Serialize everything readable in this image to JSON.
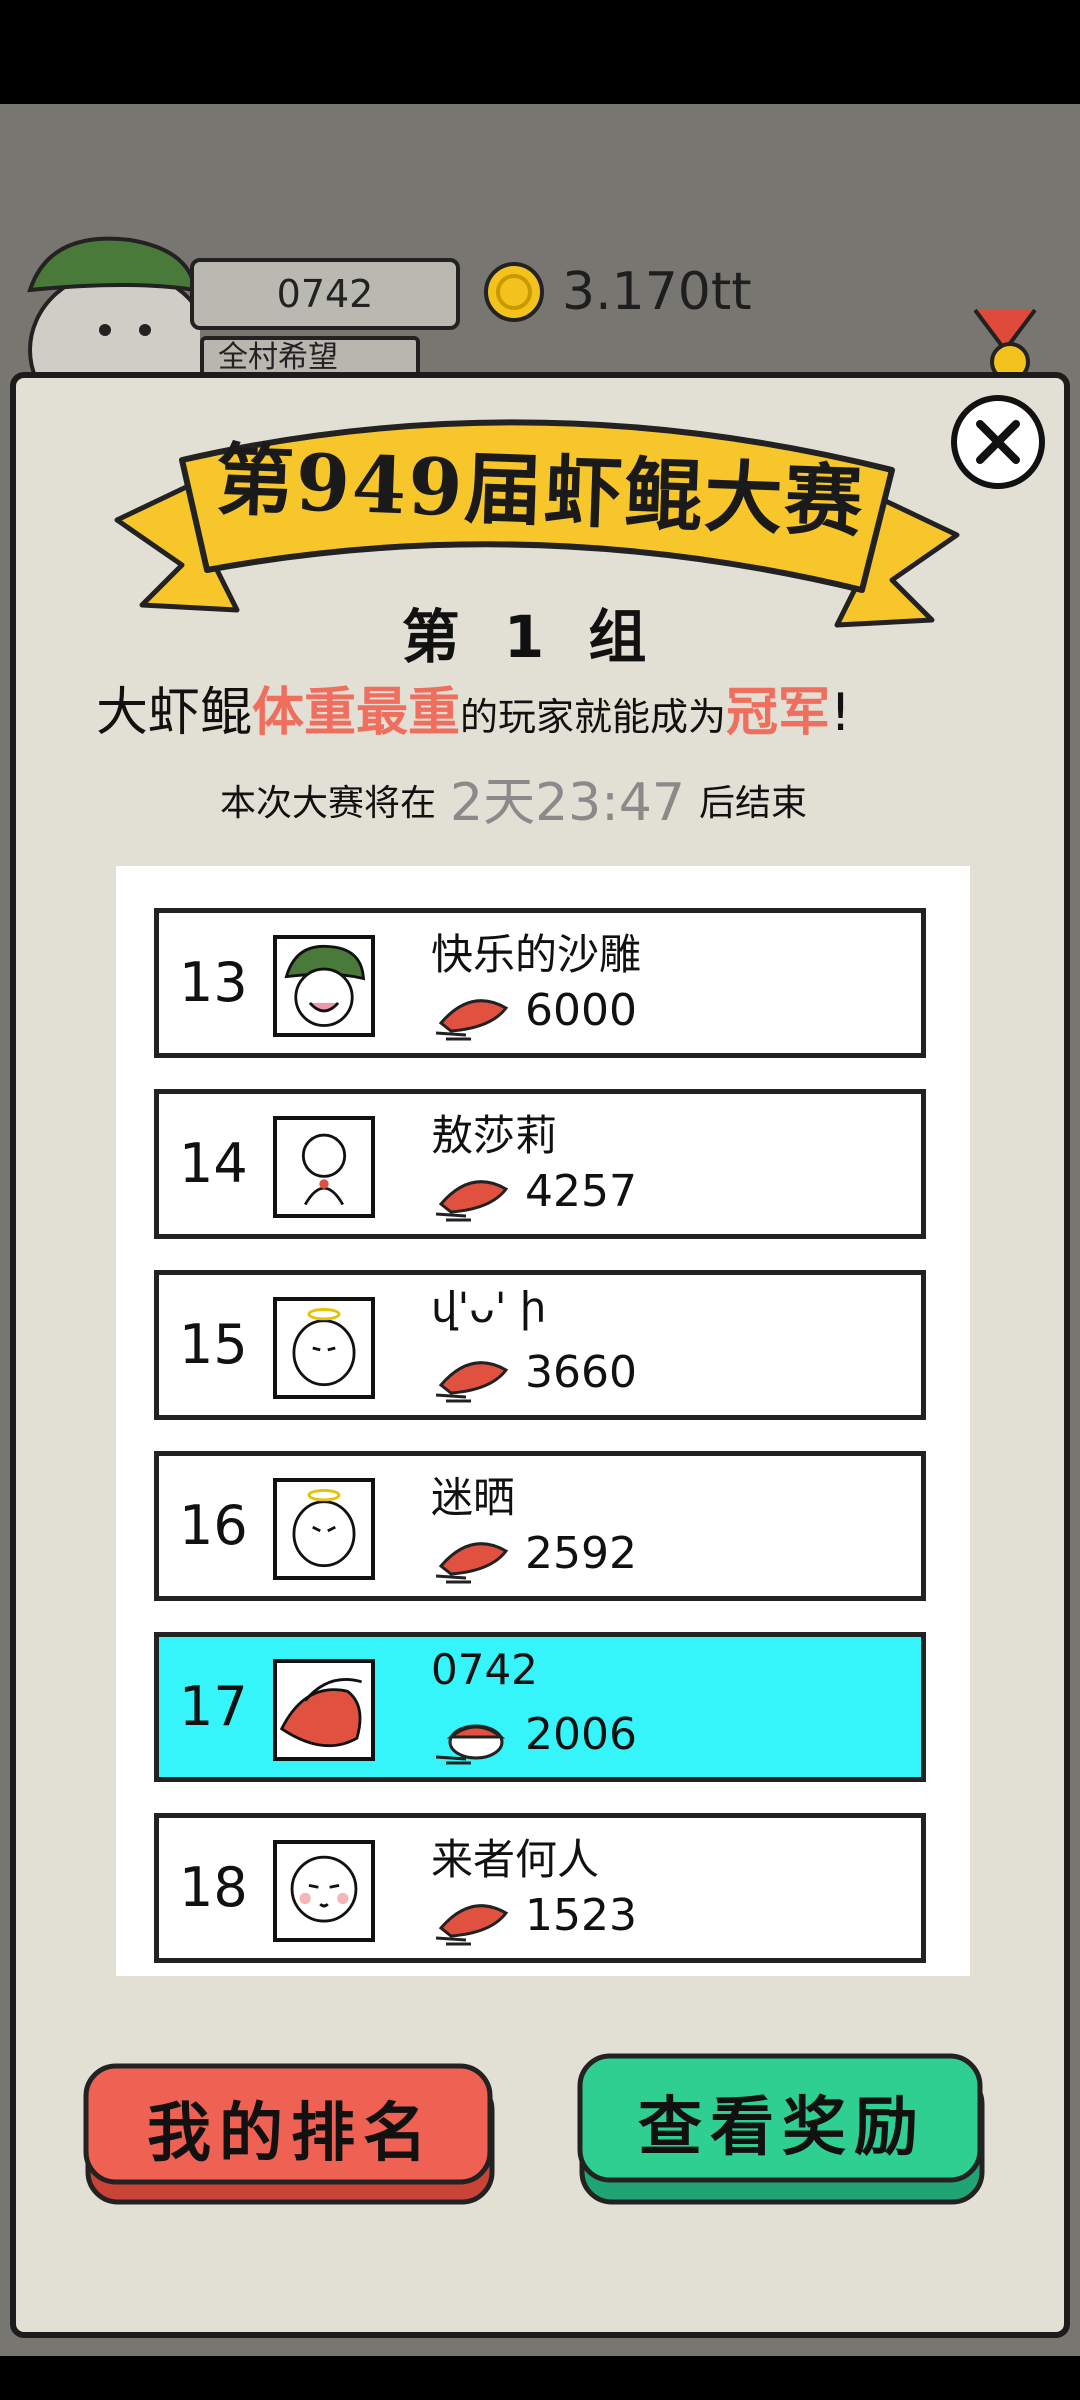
{
  "header": {
    "player_id": "0742",
    "village_tag": "全村希望",
    "coins": "3.170tt"
  },
  "modal": {
    "contest_title": "第949届虾鲲大赛",
    "group_title": "第 1 组",
    "rule": {
      "part1": "大虾鲲",
      "highlight1": "体重最重",
      "part2": "的玩家就能成为",
      "highlight2": "冠军",
      "part3": "!"
    },
    "end_prefix": "本次大赛将在",
    "end_timer": "2天23:47",
    "end_suffix": "后结束",
    "leaderboard": [
      {
        "rank": "13",
        "name": "快乐的沙雕",
        "score": "6000"
      },
      {
        "rank": "14",
        "name": "敖莎莉",
        "score": "4257"
      },
      {
        "rank": "15",
        "name": "վ'ᴗ' ի",
        "score": "3660"
      },
      {
        "rank": "16",
        "name": "迷晒",
        "score": "2592"
      },
      {
        "rank": "17",
        "name": "0742",
        "score": "2006"
      },
      {
        "rank": "18",
        "name": "来者何人",
        "score": "1523"
      }
    ],
    "my_rank_button": "我的排名",
    "view_reward_button": "查看奖励"
  },
  "colors": {
    "highlight_red": "#ef6e5e",
    "my_row_bg": "#35f5fb",
    "rank_button": "#ef6152",
    "reward_button": "#2fcf92",
    "banner_yellow": "#f7c62a"
  }
}
